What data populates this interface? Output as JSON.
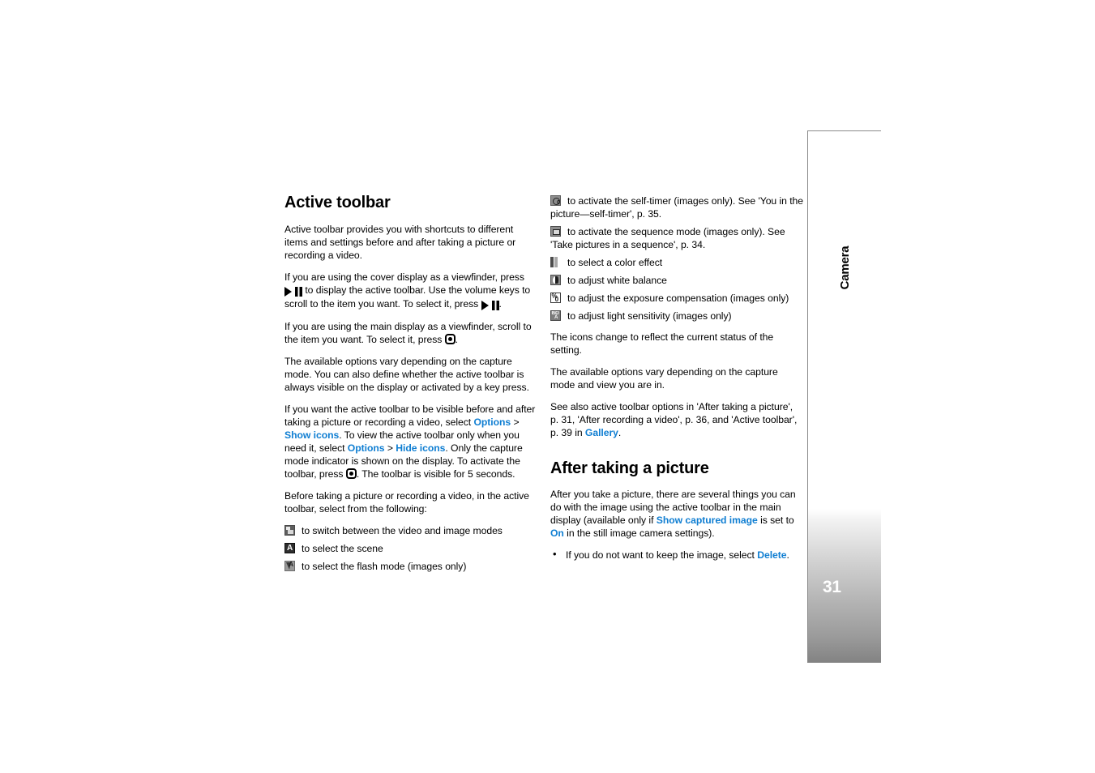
{
  "document": {
    "page_number": "31",
    "section_tab_label": "Camera",
    "link_color": "#0f7ed2"
  },
  "left_column": {
    "heading": "Active toolbar",
    "paragraphs": [
      "Active toolbar provides you with shortcuts to different items and settings before and after taking a picture or recording a video."
    ],
    "para_cover_display": {
      "part1": "If you are using the cover display as a viewfinder, press",
      "part2": "to display the active toolbar. Use the volume keys to scroll to the item you want. To select it, press",
      "part3": "."
    },
    "para_main_display": {
      "part1": "If you are using the main display as a viewfinder, scroll to the item you want. To select it, press",
      "part2": "."
    },
    "para_options_vary": "The available options vary depending on the capture mode. You can also define whether the active toolbar is always visible on the display or activated by a key press.",
    "para_show_hide": {
      "p1": "If you want the active toolbar to be visible before and after taking a picture or recording a video, select ",
      "link1": "Options",
      "sep1": " > ",
      "link2": "Show icons",
      "p2": ". To view the active toolbar only when you need it, select ",
      "link3": "Options",
      "sep2": " > ",
      "link4": "Hide icons",
      "p3": ". Only the capture mode indicator is shown on the display. To activate the toolbar, press",
      "p4": ". The toolbar is visible for 5 seconds."
    },
    "para_before_taking": "Before taking a picture or recording a video, in the active toolbar, select from the following:",
    "icon_items": [
      {
        "icon": "video-image-mode-icon",
        "text": "to switch between the video and image modes"
      },
      {
        "icon": "scene-mode-icon",
        "text": "to select the scene"
      },
      {
        "icon": "flash-mode-icon",
        "text": "to select the flash mode (images only)"
      }
    ]
  },
  "right_column": {
    "icon_items": [
      {
        "icon": "self-timer-icon",
        "text": "to activate the self-timer (images only). See 'You in the picture—self-timer', p. 35."
      },
      {
        "icon": "sequence-mode-icon",
        "text": "to activate the sequence mode (images only). See 'Take pictures in a sequence', p. 34."
      },
      {
        "icon": "color-effect-icon",
        "text": "to select a color effect"
      },
      {
        "icon": "white-balance-icon",
        "text": "to adjust white balance"
      },
      {
        "icon": "exposure-compensation-icon",
        "text": "to adjust the exposure compensation (images only)"
      },
      {
        "icon": "light-sensitivity-icon",
        "text": "to adjust light sensitivity (images only)"
      }
    ],
    "para_icons_change": "The icons change to reflect the current status of the setting.",
    "para_options_vary": "The available options vary depending on the capture mode and view you are in.",
    "para_see_also": {
      "p1": "See also active toolbar options in 'After taking a picture', p. 31, 'After recording a video', p. 36, and 'Active toolbar', p. 39 in ",
      "link1": "Gallery",
      "p2": "."
    },
    "heading2": "After taking a picture",
    "para_after_taking": {
      "p1": "After you take a picture, there are several things you can do with the image using the active toolbar in the main display (available only if ",
      "link1": "Show captured image",
      "p2": " is set to ",
      "link2": "On",
      "p3": " in the still image camera settings)."
    },
    "bullets": [
      {
        "p1": "If you do not want to keep the image, select ",
        "link1": "Delete",
        "p2": "."
      }
    ]
  }
}
